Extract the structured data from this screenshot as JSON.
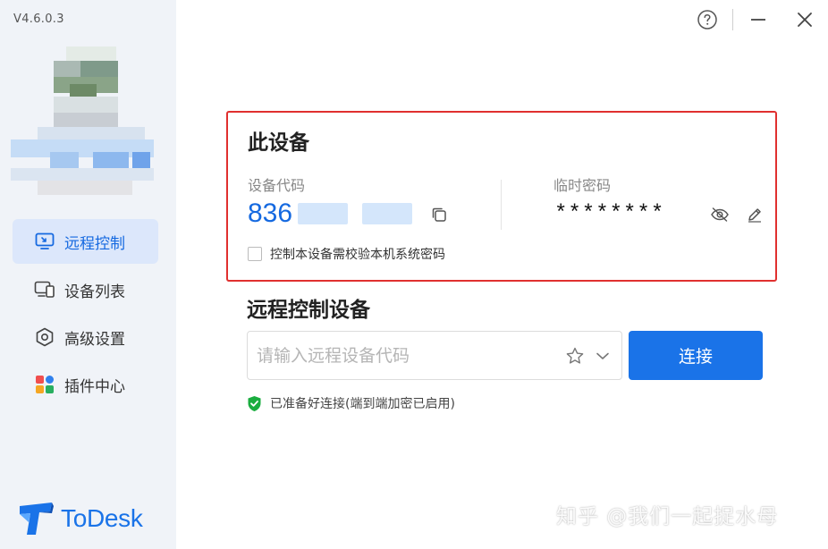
{
  "app": {
    "version": "V4.6.0.3",
    "logo_text": "ToDesk"
  },
  "window_controls": {
    "help_icon": "help-circle-icon",
    "minimize_icon": "minimize-icon",
    "close_icon": "close-icon"
  },
  "sidebar": {
    "items": [
      {
        "label": "远程控制",
        "icon": "monitor-remote-icon",
        "active": true
      },
      {
        "label": "设备列表",
        "icon": "devices-icon",
        "active": false
      },
      {
        "label": "高级设置",
        "icon": "hexagon-settings-icon",
        "active": false
      },
      {
        "label": "插件中心",
        "icon": "plugins-grid-icon",
        "active": false
      }
    ]
  },
  "this_device": {
    "title": "此设备",
    "code_label": "设备代码",
    "code_value": "836",
    "password_label": "临时密码",
    "password_value": "********",
    "checkbox_label": "控制本设备需校验本机系统密码",
    "checkbox_checked": false
  },
  "remote": {
    "title": "远程控制设备",
    "input_placeholder": "请输入远程设备代码",
    "input_value": "",
    "connect_label": "连接",
    "status_text": "已准备好连接(端到端加密已启用)"
  },
  "watermark": "知乎 @我们一起捉水母",
  "colors": {
    "accent": "#1a73e8",
    "highlight_border": "#e0302f",
    "status_green": "#1aad3f",
    "sidebar_bg": "#f0f3f8"
  }
}
